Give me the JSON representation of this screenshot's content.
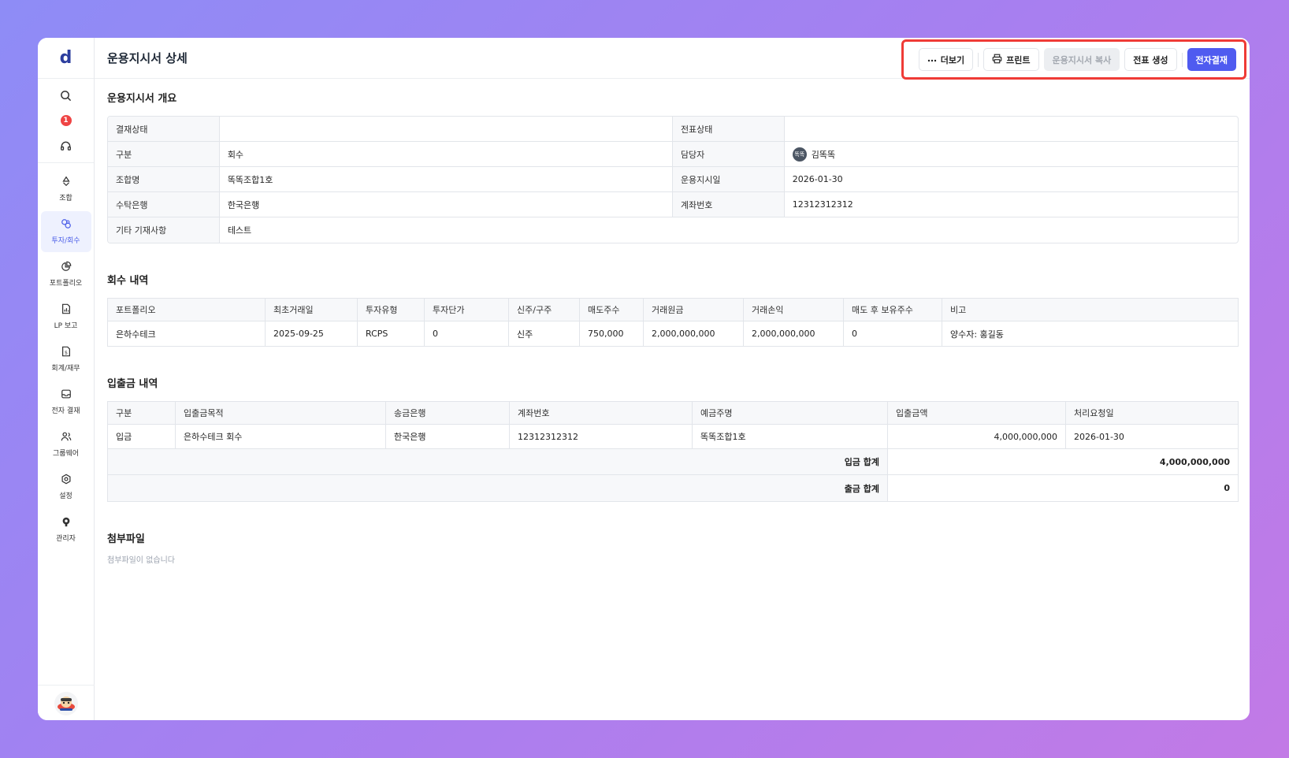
{
  "app": {
    "logo": "d",
    "notification_count": "1"
  },
  "nav": [
    {
      "key": "fund",
      "label": "조합",
      "icon": "recycle-icon",
      "active": false
    },
    {
      "key": "invest",
      "label": "투자/회수",
      "icon": "coins-icon",
      "active": true
    },
    {
      "key": "portfolio",
      "label": "포트폴리오",
      "icon": "pie-chart-icon",
      "active": false
    },
    {
      "key": "lp",
      "label": "LP 보고",
      "icon": "report-icon",
      "active": false
    },
    {
      "key": "account",
      "label": "회계/재무",
      "icon": "finance-file-icon",
      "active": false
    },
    {
      "key": "approval",
      "label": "전자 결재",
      "icon": "inbox-icon",
      "active": false
    },
    {
      "key": "groupware",
      "label": "그룹웨어",
      "icon": "users-icon",
      "active": false
    },
    {
      "key": "settings",
      "label": "설정",
      "icon": "gear-icon",
      "active": false
    },
    {
      "key": "admin",
      "label": "관리자",
      "icon": "admin-icon",
      "active": false
    }
  ],
  "header": {
    "title": "운용지시서 상세",
    "more": "더보기",
    "print": "프린트",
    "copy": "운용지시서 복사",
    "voucher": "전표 생성",
    "approve": "전자결재"
  },
  "overview": {
    "title": "운용지시서 개요",
    "approval_status_label": "결재상태",
    "approval_status": "",
    "voucher_status_label": "전표상태",
    "voucher_status": "",
    "type_label": "구분",
    "type": "회수",
    "manager_label": "담당자",
    "manager_avatar": "똑똑",
    "manager": "김똑똑",
    "fund_label": "조합명",
    "fund": "똑똑조합1호",
    "date_label": "운용지시일",
    "date": "2026-01-30",
    "bank_label": "수탁은행",
    "bank": "한국은행",
    "account_label": "계좌번호",
    "account": "12312312312",
    "etc_label": "기타 기재사항",
    "etc": "테스트"
  },
  "recovery": {
    "title": "회수 내역",
    "headers": [
      "포트폴리오",
      "최초거래일",
      "투자유형",
      "투자단가",
      "신주/구주",
      "매도주수",
      "거래원금",
      "거래손익",
      "매도 후 보유주수",
      "비고"
    ],
    "rows": [
      [
        "은하수테크",
        "2025-09-25",
        "RCPS",
        "0",
        "신주",
        "750,000",
        "2,000,000,000",
        "2,000,000,000",
        "0",
        "양수자: 홍길동"
      ]
    ]
  },
  "cashflow": {
    "title": "입출금 내역",
    "headers": [
      "구분",
      "입출금목적",
      "송금은행",
      "계좌번호",
      "예금주명",
      "입출금액",
      "처리요청일"
    ],
    "rows": [
      [
        "입금",
        "은하수테크 회수",
        "한국은행",
        "12312312312",
        "똑똑조합1호",
        "4,000,000,000",
        "2026-01-30"
      ]
    ],
    "in_total_label": "입금 합계",
    "in_total": "4,000,000,000",
    "out_total_label": "출금 합계",
    "out_total": "0"
  },
  "attachments": {
    "title": "첨부파일",
    "empty": "첨부파일이 없습니다"
  }
}
